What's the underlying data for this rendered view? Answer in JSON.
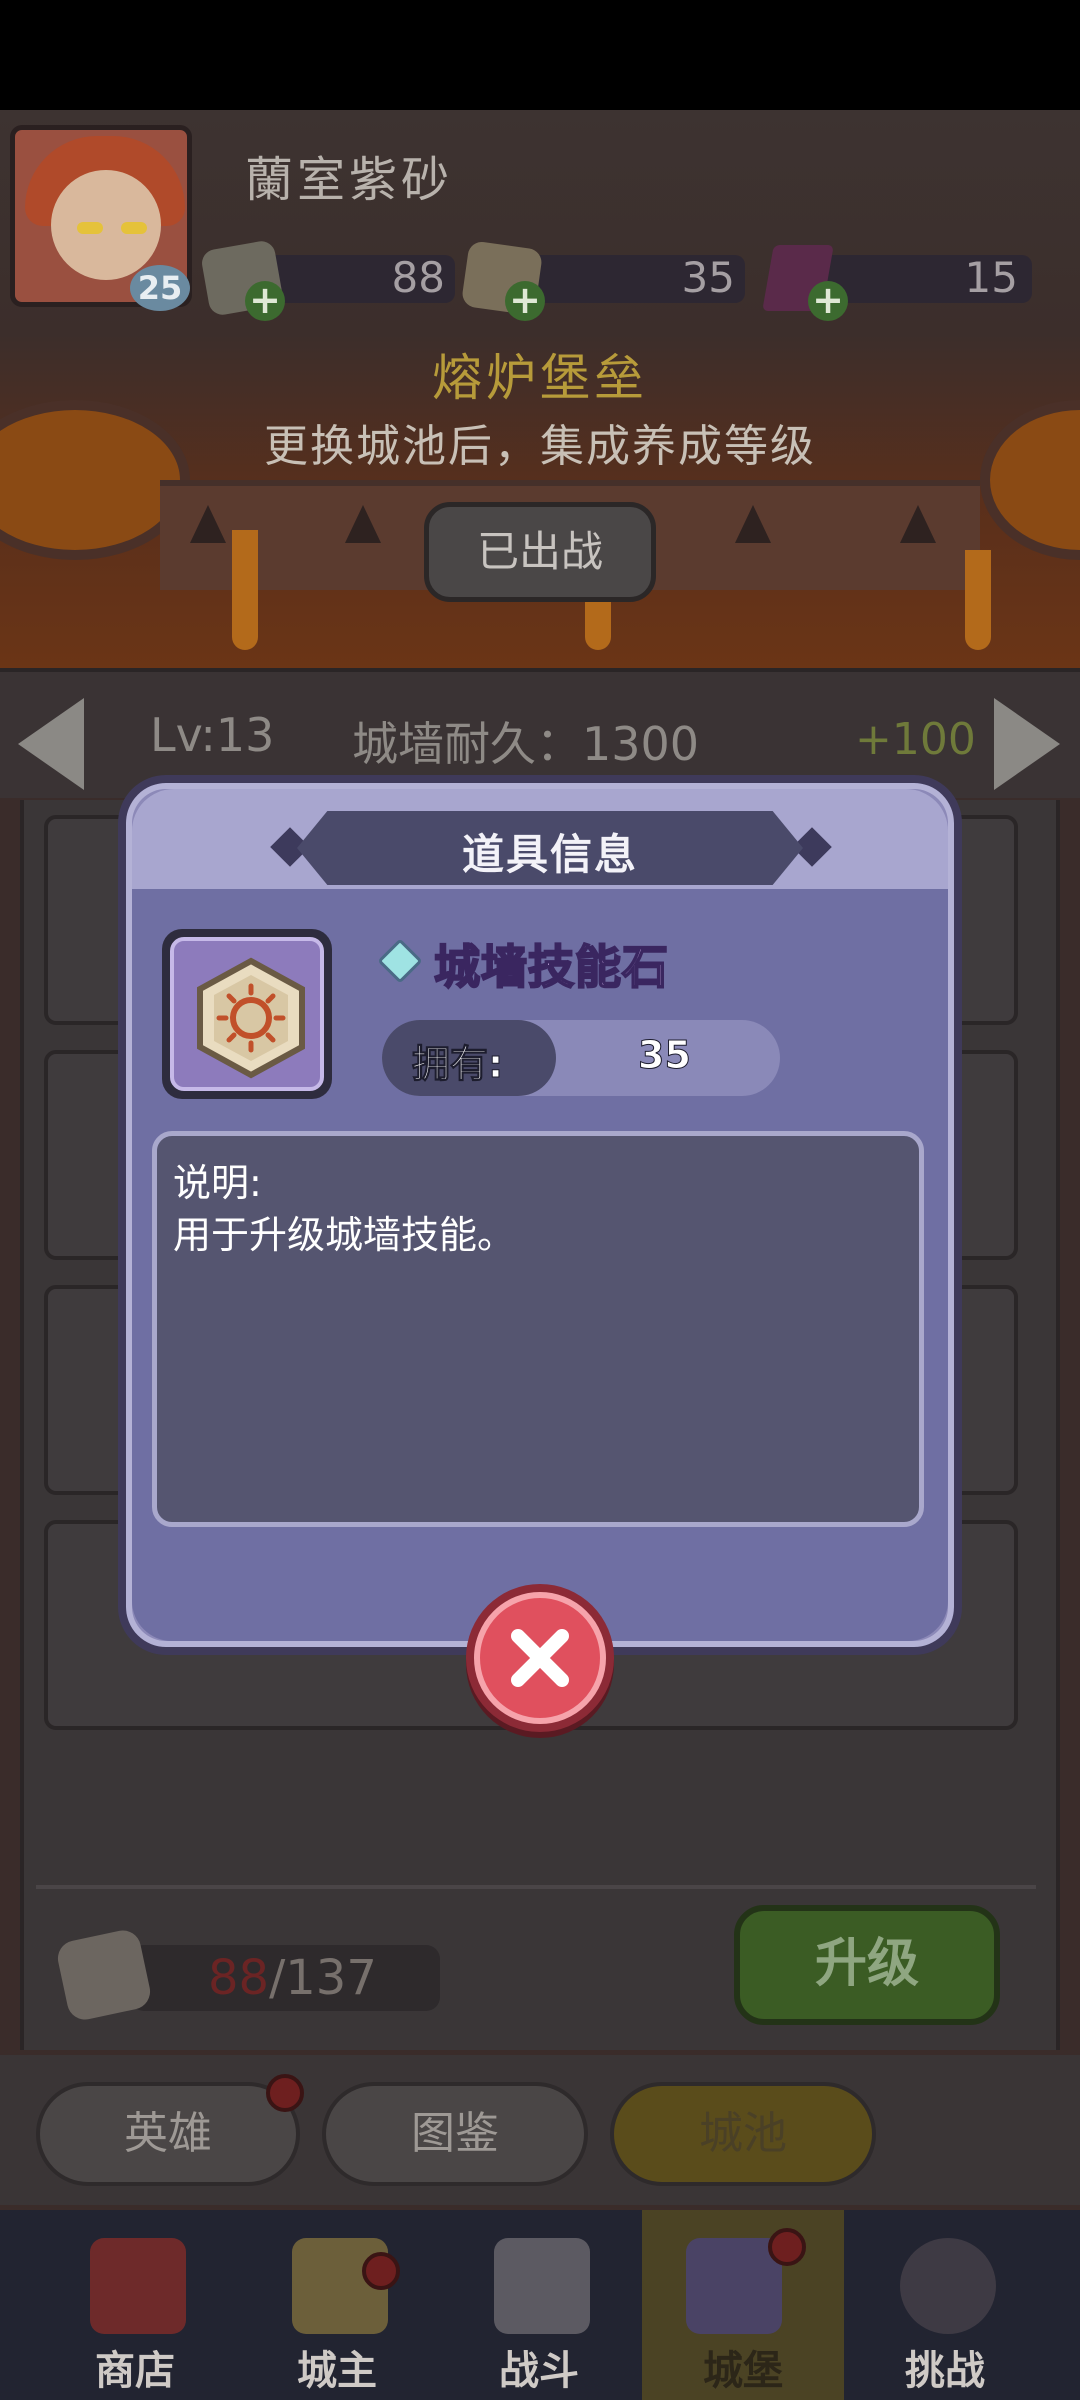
{
  "player": {
    "name": "蘭室紫砂",
    "level": "25"
  },
  "resources": [
    {
      "name": "wall-stone-blue",
      "value": "88"
    },
    {
      "name": "wall-skill-stone",
      "value": "35"
    },
    {
      "name": "purple-gem",
      "value": "15"
    }
  ],
  "fortress": {
    "title": "熔炉堡垒",
    "subtitle": "更换城池后，集成养成等级",
    "deploy_label": "已出战"
  },
  "wall": {
    "level": "Lv:13",
    "durability": "城墙耐久：1300",
    "bonus": "+100"
  },
  "upgrade": {
    "have": "88",
    "need": "/137",
    "button": "升级"
  },
  "subtabs": [
    {
      "label": "英雄"
    },
    {
      "label": "图鉴"
    },
    {
      "label": "城池"
    }
  ],
  "bottom_nav": [
    {
      "label": "商店"
    },
    {
      "label": "城主"
    },
    {
      "label": "战斗"
    },
    {
      "label": "城堡"
    },
    {
      "label": "挑战"
    }
  ],
  "dialog": {
    "title": "道具信息",
    "item_name": "城墙技能石",
    "own_label": "拥有:",
    "own_value": "35",
    "desc_title": "说明:",
    "desc_text": "用于升级城墙技能。"
  },
  "colors": {
    "dialog_bg": "#8c89b8",
    "item_name": "#e6c9ff",
    "close_button": "#e0505e"
  }
}
